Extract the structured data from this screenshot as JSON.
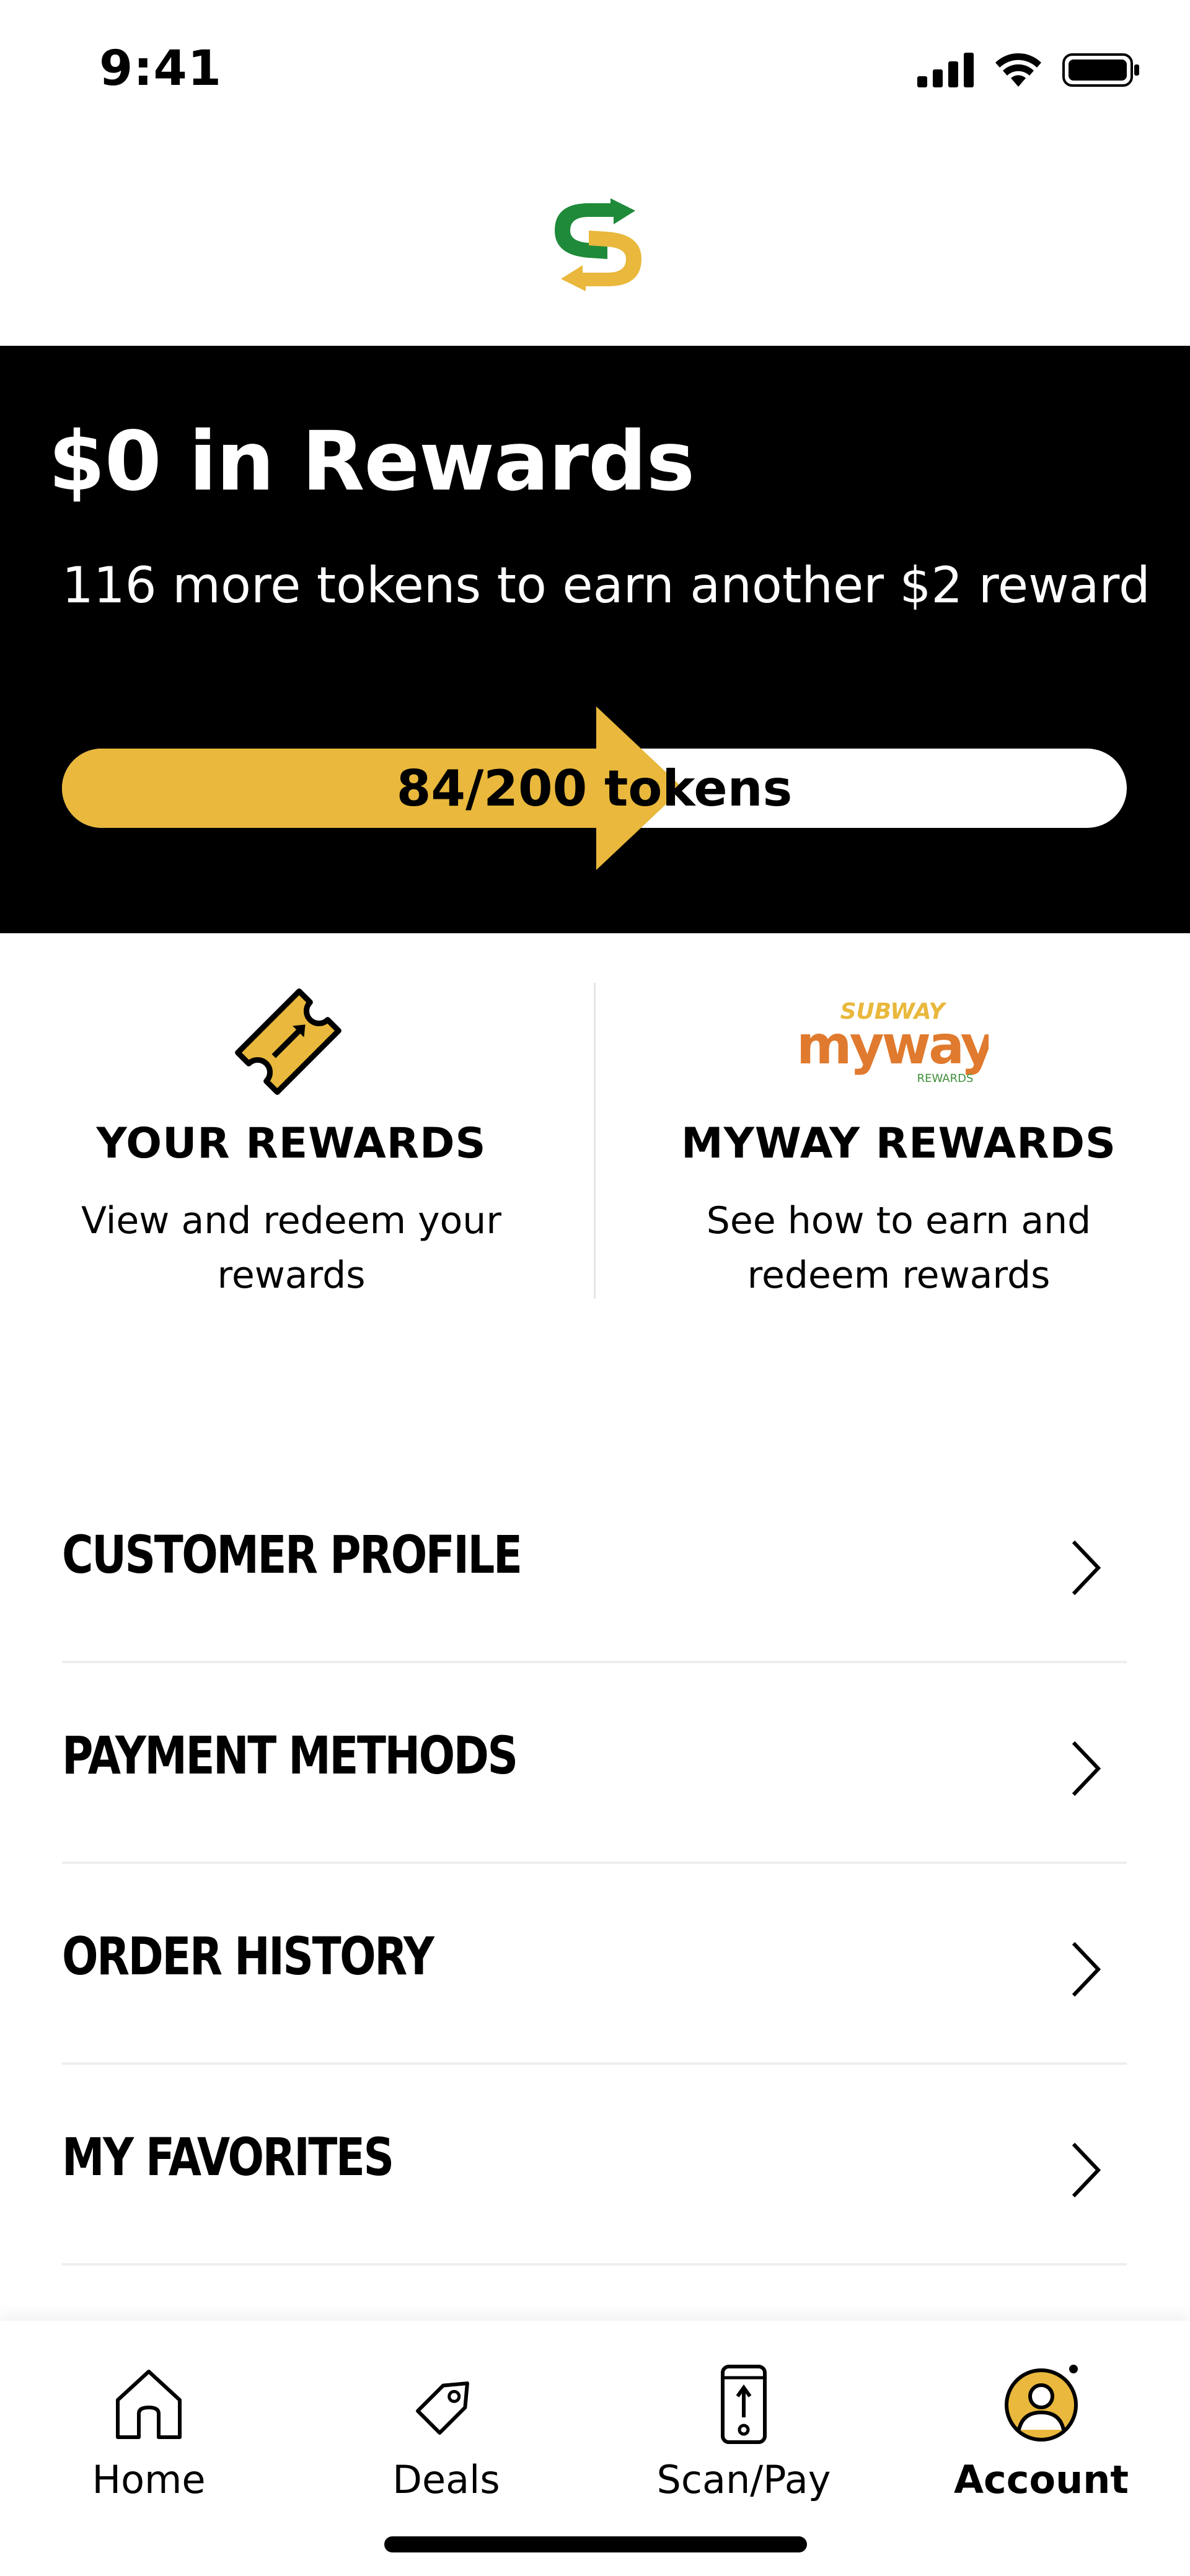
{
  "status_bar": {
    "time": "9:41"
  },
  "rewards": {
    "title": "$0 in Rewards",
    "subtitle": "116 more tokens to earn another $2 reward",
    "progress_label": "84/200 tokens",
    "tokens_current": 84,
    "tokens_goal": 200,
    "accent_color": "#e9b83c"
  },
  "tiles": [
    {
      "title": "YOUR REWARDS",
      "desc": "View and redeem your rewards",
      "icon": "ticket-icon"
    },
    {
      "title": "MYWAY REWARDS",
      "desc": "See how to earn and redeem rewards",
      "icon": "subway-myway-logo",
      "logo_text": {
        "brand": "SUBWAY",
        "name": "myway",
        "tag": "REWARDS"
      }
    }
  ],
  "menu": [
    {
      "label": "CUSTOMER PROFILE"
    },
    {
      "label": "PAYMENT METHODS"
    },
    {
      "label": "ORDER HISTORY"
    },
    {
      "label": "MY FAVORITES"
    }
  ],
  "tabs": [
    {
      "label": "Home",
      "icon": "home-icon"
    },
    {
      "label": "Deals",
      "icon": "tag-icon"
    },
    {
      "label": "Scan/Pay",
      "icon": "phone-scan-icon"
    },
    {
      "label": "Account",
      "icon": "account-avatar-icon",
      "active": true
    }
  ],
  "colors": {
    "subway_green": "#1f8a3a",
    "subway_yellow": "#e9b83c",
    "myway_orange": "#e07a2e",
    "myway_green": "#3f8f3a"
  }
}
